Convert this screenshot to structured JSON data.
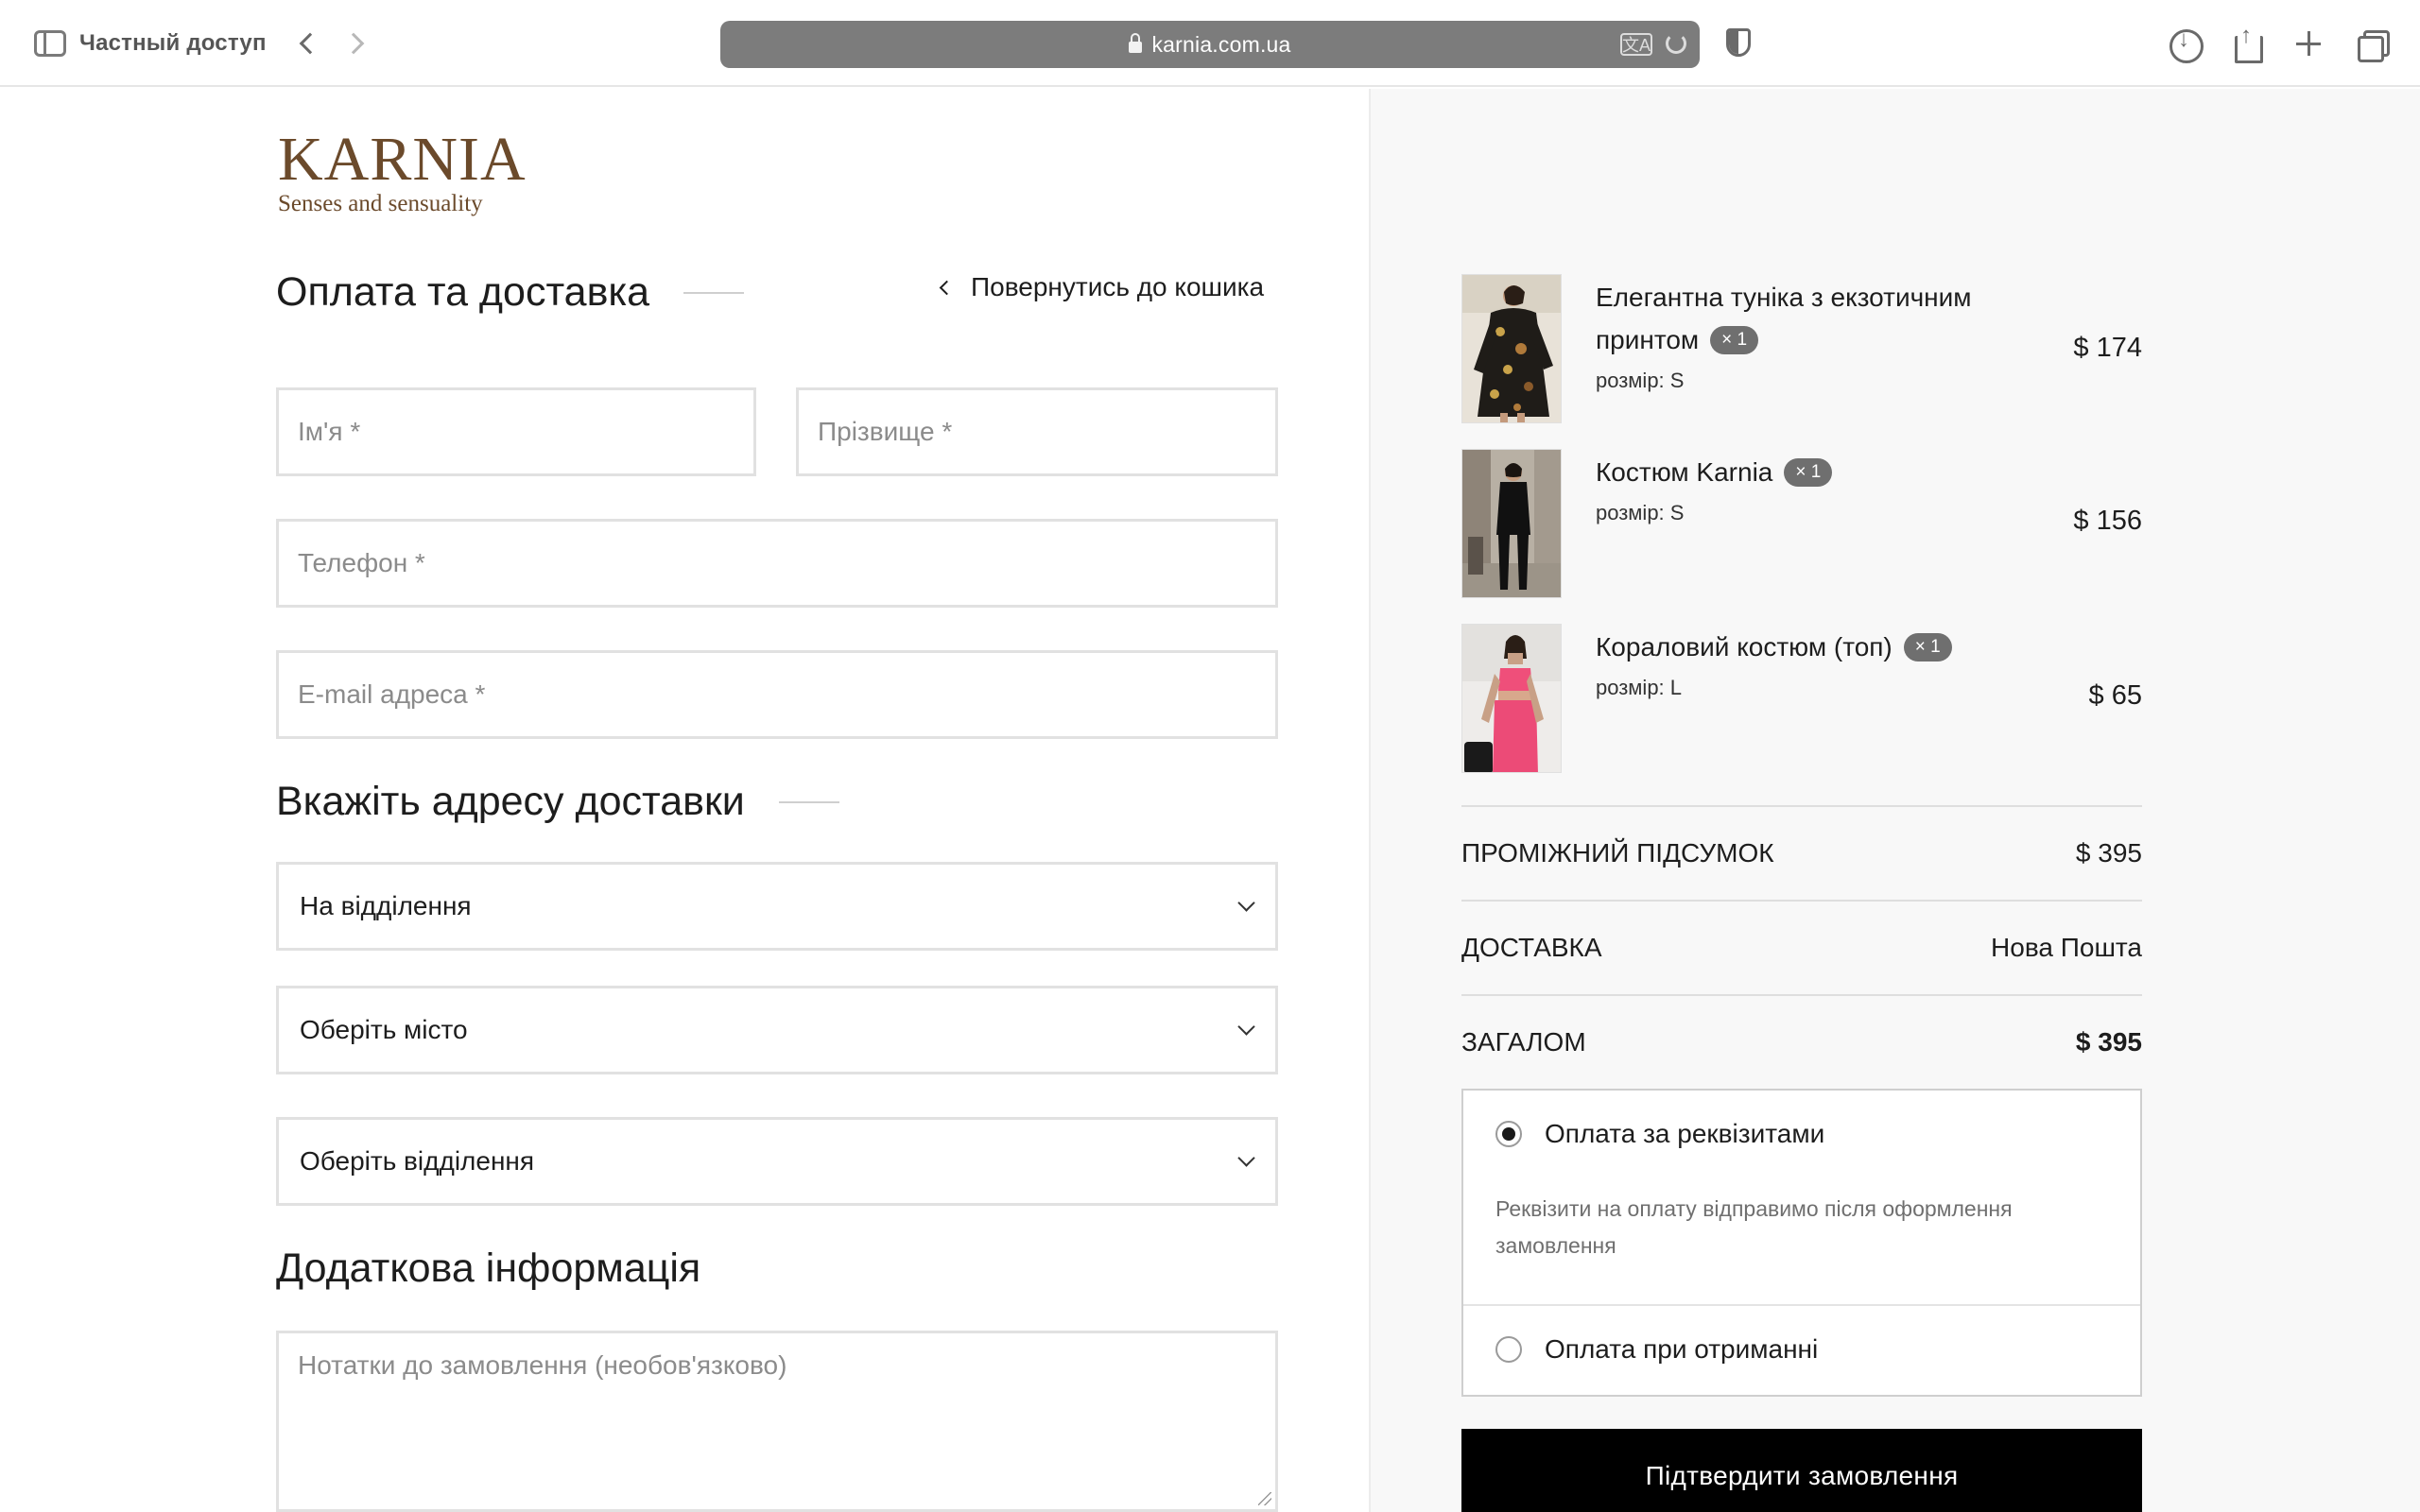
{
  "browser": {
    "private_label": "Частный доступ",
    "url": "karnia.com.ua",
    "translate_glyph": "文A"
  },
  "logo": {
    "main": "KARNIA",
    "tagline": "Senses and sensuality"
  },
  "form": {
    "title": "Оплата та доставка",
    "back_link": "Повернутись до кошика",
    "first_name_placeholder": "Ім'я *",
    "last_name_placeholder": "Прізвище *",
    "phone_placeholder": "Телефон *",
    "email_placeholder": "E-mail адреса *",
    "address_title": "Вкажіть адресу доставки",
    "delivery_type": "На відділення",
    "city_select": "Оберіть місто",
    "branch_select": "Оберіть відділення",
    "extra_title": "Додаткова інформація",
    "notes_placeholder": "Нотатки до замовлення (необов'язково)"
  },
  "order": {
    "items": [
      {
        "name": "Елегантна туніка з екзотичним принтом",
        "qty": "× 1",
        "size_label": "розмір:",
        "size": "S",
        "price": "$ 174"
      },
      {
        "name": "Костюм Karnia",
        "qty": "× 1",
        "size_label": "розмір:",
        "size": "S",
        "price": "$ 156"
      },
      {
        "name": "Кораловий костюм (топ)",
        "qty": "× 1",
        "size_label": "розмір:",
        "size": "L",
        "price": "$ 65"
      }
    ],
    "subtotal_label": "ПРОМІЖНИЙ ПІДСУМОК",
    "subtotal_value": "$ 395",
    "shipping_label": "ДОСТАВКА",
    "shipping_value": "Нова Пошта",
    "total_label": "ЗАГАЛОМ",
    "total_value": "$ 395",
    "payment": {
      "option1": "Оплата за реквізитами",
      "option1_desc": "Реквізити на оплату відправимо після оформлення замовлення",
      "option2": "Оплата при отриманні",
      "selected": "option1"
    },
    "confirm_label": "Підтвердити замовлення"
  },
  "colors": {
    "brand": "#6b4a2b",
    "button": "#000000",
    "badge": "#6f6f6f"
  }
}
